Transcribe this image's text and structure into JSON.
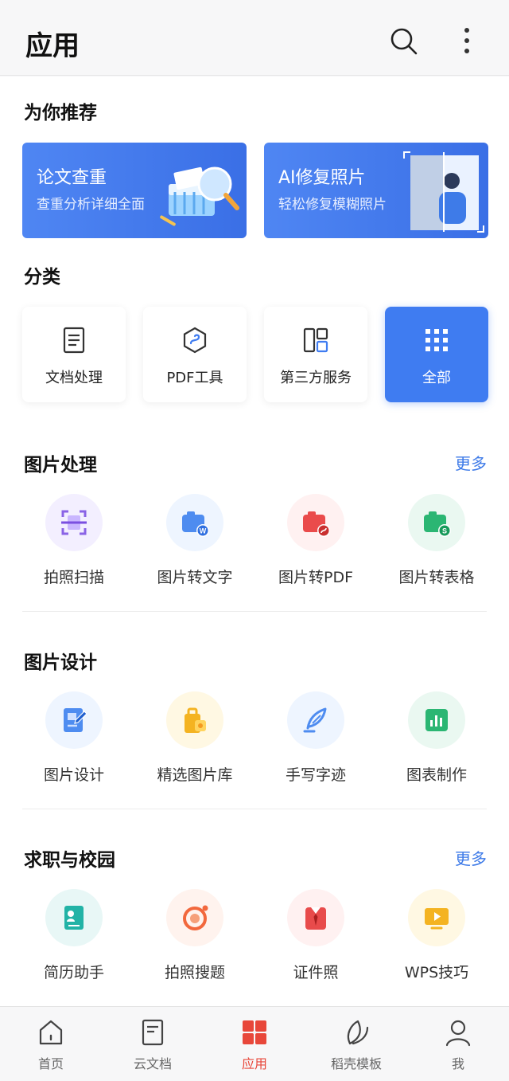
{
  "header": {
    "title": "应用"
  },
  "recommend": {
    "title": "为你推荐",
    "cards": [
      {
        "title": "论文查重",
        "subtitle": "查重分析详细全面"
      },
      {
        "title": "AI修复照片",
        "subtitle": "轻松修复模糊照片"
      }
    ]
  },
  "categories": {
    "title": "分类",
    "items": [
      {
        "label": "文档处理",
        "icon": "document-icon"
      },
      {
        "label": "PDF工具",
        "icon": "pdf-hexagon-icon"
      },
      {
        "label": "第三方服务",
        "icon": "services-grid-icon"
      },
      {
        "label": "全部",
        "icon": "apps-grid-icon"
      }
    ]
  },
  "image_processing": {
    "title": "图片处理",
    "more": "更多",
    "items": [
      {
        "label": "拍照扫描",
        "icon": "scan-icon"
      },
      {
        "label": "图片转文字",
        "icon": "image-to-word-icon"
      },
      {
        "label": "图片转PDF",
        "icon": "image-to-pdf-icon"
      },
      {
        "label": "图片转表格",
        "icon": "image-to-sheet-icon"
      }
    ]
  },
  "image_design": {
    "title": "图片设计",
    "items": [
      {
        "label": "图片设计",
        "icon": "design-edit-icon"
      },
      {
        "label": "精选图片库",
        "icon": "image-library-icon"
      },
      {
        "label": "手写字迹",
        "icon": "quill-pen-icon"
      },
      {
        "label": "图表制作",
        "icon": "bar-chart-icon"
      }
    ]
  },
  "career": {
    "title": "求职与校园",
    "more": "更多",
    "items": [
      {
        "label": "简历助手",
        "icon": "resume-icon"
      },
      {
        "label": "拍照搜题",
        "icon": "photo-search-icon"
      },
      {
        "label": "证件照",
        "icon": "id-photo-icon"
      },
      {
        "label": "WPS技巧",
        "icon": "video-tips-icon"
      }
    ]
  },
  "tabbar": {
    "items": [
      {
        "label": "首页",
        "icon": "home-icon"
      },
      {
        "label": "云文档",
        "icon": "cloud-doc-icon"
      },
      {
        "label": "应用",
        "icon": "apps-icon",
        "active": true
      },
      {
        "label": "稻壳模板",
        "icon": "leaf-icon"
      },
      {
        "label": "我",
        "icon": "profile-icon"
      }
    ]
  },
  "colors": {
    "accent": "#3f7cf1",
    "active_tab": "#e8473a",
    "link": "#3d7ae8"
  }
}
